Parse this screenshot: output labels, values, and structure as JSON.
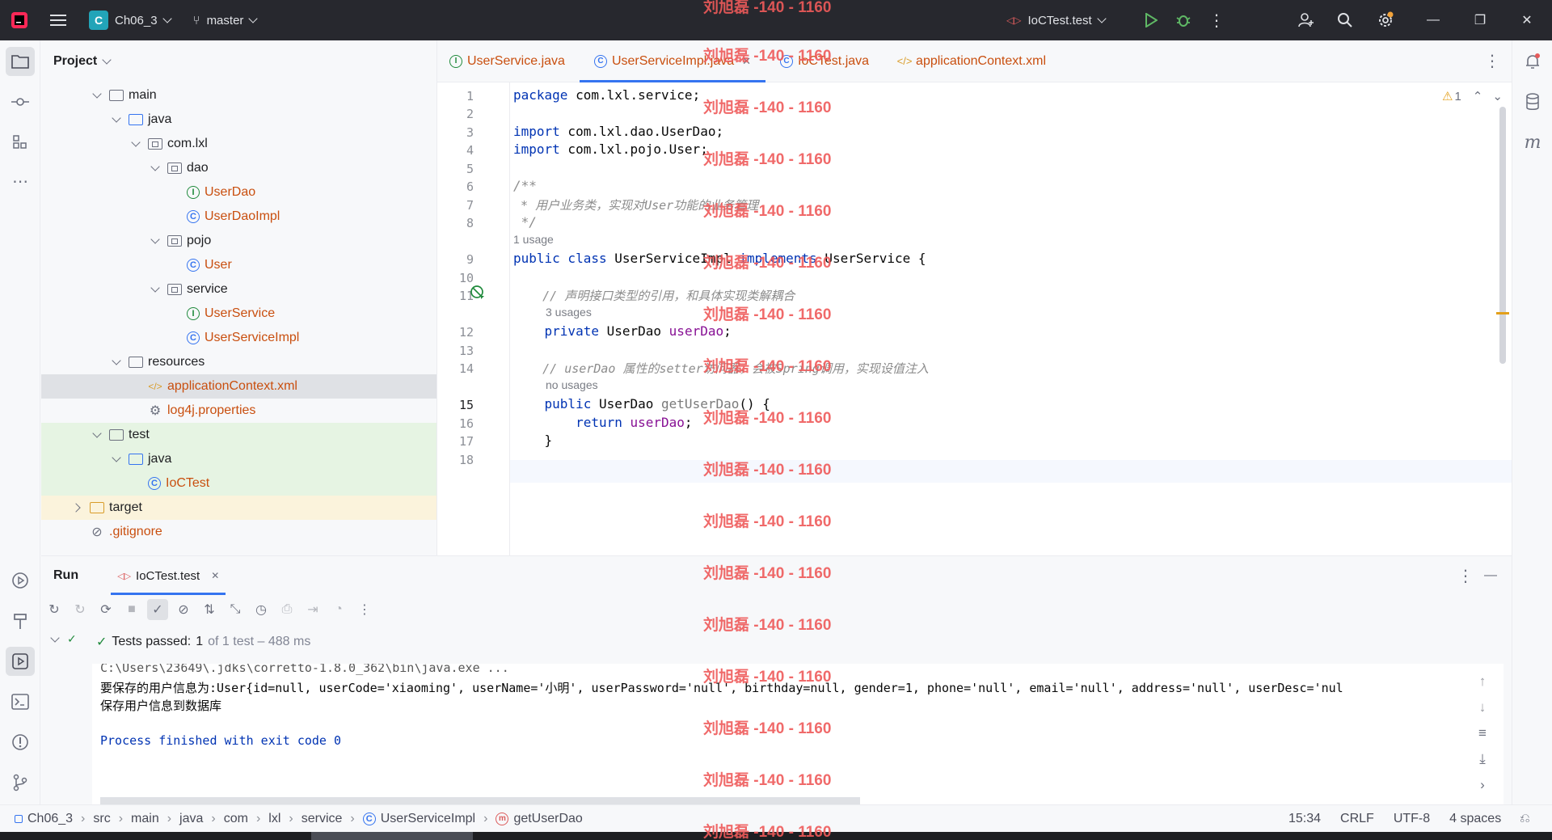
{
  "titlebar": {
    "project_badge": "C",
    "project_name": "Ch06_3",
    "branch": "master",
    "run_config": "IoCTest.test"
  },
  "project_panel": {
    "title": "Project",
    "tree": [
      {
        "label": "main",
        "kind": "folder",
        "depth": 2,
        "expanded": true
      },
      {
        "label": "java",
        "kind": "folder-blue",
        "depth": 3,
        "expanded": true
      },
      {
        "label": "com.lxl",
        "kind": "package",
        "depth": 4,
        "expanded": true
      },
      {
        "label": "dao",
        "kind": "package",
        "depth": 5,
        "expanded": true
      },
      {
        "label": "UserDao",
        "kind": "interface",
        "depth": 6
      },
      {
        "label": "UserDaoImpl",
        "kind": "class",
        "depth": 6
      },
      {
        "label": "pojo",
        "kind": "package",
        "depth": 5,
        "expanded": true
      },
      {
        "label": "User",
        "kind": "class",
        "depth": 6
      },
      {
        "label": "service",
        "kind": "package",
        "depth": 5,
        "expanded": true
      },
      {
        "label": "UserService",
        "kind": "interface",
        "depth": 6
      },
      {
        "label": "UserServiceImpl",
        "kind": "class",
        "depth": 6
      },
      {
        "label": "resources",
        "kind": "folder-res",
        "depth": 3,
        "expanded": true
      },
      {
        "label": "applicationContext.xml",
        "kind": "xml",
        "depth": 4,
        "selected": true
      },
      {
        "label": "log4j.properties",
        "kind": "props",
        "depth": 4
      },
      {
        "label": "test",
        "kind": "folder",
        "depth": 2,
        "expanded": true
      },
      {
        "label": "java",
        "kind": "folder-green",
        "depth": 3,
        "expanded": true
      },
      {
        "label": "IoCTest",
        "kind": "class",
        "depth": 4
      },
      {
        "label": "target",
        "kind": "folder-orange",
        "depth": 1,
        "expanded": false
      },
      {
        "label": ".gitignore",
        "kind": "ignore",
        "depth": 1
      }
    ]
  },
  "editor_tabs": [
    {
      "label": "UserService.java",
      "kind": "interface"
    },
    {
      "label": "UserServiceImpl.java",
      "kind": "class",
      "active": true
    },
    {
      "label": "IoCTest.java",
      "kind": "class"
    },
    {
      "label": "applicationContext.xml",
      "kind": "xml"
    }
  ],
  "editor": {
    "warning_count": "1",
    "line_numbers": [
      "1",
      "2",
      "3",
      "4",
      "5",
      "6",
      "7",
      "8",
      "9",
      "10",
      "11",
      "12",
      "13",
      "14",
      "15",
      "16",
      "17",
      "18"
    ],
    "code": {
      "l1_kw": "package",
      "l1_rest": " com.lxl.service;",
      "l3_kw": "import",
      "l3_rest": " com.lxl.dao.UserDao;",
      "l4_kw": "import",
      "l4_rest": " com.lxl.pojo.User;",
      "l6": "/**",
      "l7": " * 用户业务类，实现对User功能的业务管理",
      "l8": " */",
      "hint_9": "1 usage",
      "l9_kw1": "public class",
      "l9_name": " UserServiceImpl ",
      "l9_kw2": "implements",
      "l9_rest": " UserService {",
      "l11": "    // 声明接口类型的引用，和具体实现类解耦合",
      "hint_12": "3 usages",
      "l12_kw": "    private",
      "l12_type": " UserDao ",
      "l12_field": "userDao",
      "l12_end": ";",
      "l14": "    // userDao 属性的setter访问器，会被Spring调用，实现设值注入",
      "hint_15": "no usages",
      "l15_kw": "    public",
      "l15_type": " UserDao ",
      "l15_method": "getUserDao",
      "l15_end": "() {",
      "l16_kw": "        return",
      "l16_field": " userDao",
      "l16_end": ";",
      "l17": "    }"
    }
  },
  "run_panel": {
    "title": "Run",
    "tab": "IoCTest.test",
    "tests_passed_label": "Tests passed:",
    "tests_passed_count": "1",
    "tests_passed_rest": "of 1 test – 488 ms",
    "console": [
      "C:\\Users\\23649\\.jdks\\corretto-1.8.0_362\\bin\\java.exe ...",
      "要保存的用户信息为:User{id=null, userCode='xiaoming', userName='小明', userPassword='null', birthday=null, gender=1, phone='null', email='null', address='null', userDesc='nul",
      "保存用户信息到数据库",
      "",
      "Process finished with exit code 0"
    ]
  },
  "statusbar": {
    "breadcrumb": [
      "Ch06_3",
      "src",
      "main",
      "java",
      "com",
      "lxl",
      "service",
      "UserServiceImpl",
      "getUserDao"
    ],
    "position": "15:34",
    "line_sep": "CRLF",
    "encoding": "UTF-8",
    "indent": "4 spaces"
  },
  "watermark": "刘旭磊 -140 - 1160",
  "colors": {
    "accent": "#3574f0",
    "java_file": "#c94f0f",
    "success": "#208a3c",
    "watermark": "#ef5a5a"
  }
}
